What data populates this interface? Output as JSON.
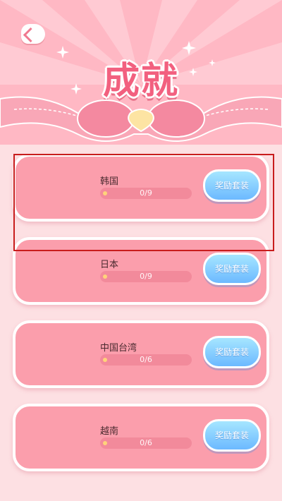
{
  "header": {
    "title": "成就"
  },
  "achievements": [
    {
      "name": "韩国",
      "progress": "0/9",
      "button": "奖励套装"
    },
    {
      "name": "日本",
      "progress": "0/9",
      "button": "奖励套装"
    },
    {
      "name": "中国台湾",
      "progress": "0/6",
      "button": "奖励套装"
    },
    {
      "name": "越南",
      "progress": "0/6",
      "button": "奖励套装"
    }
  ],
  "colors": {
    "header_bg": "#ffb8c4",
    "title": "#f2607f",
    "card_bg": "#fb9eac",
    "button": "#6cb9ff",
    "highlight": "#c81d1d"
  }
}
